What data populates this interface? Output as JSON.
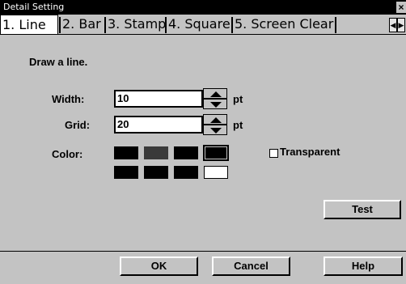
{
  "window": {
    "title": "Detail Setting",
    "close_glyph": "×"
  },
  "tabs": [
    {
      "label": "1. Line",
      "selected": true
    },
    {
      "label": "2. Bar",
      "selected": false
    },
    {
      "label": "3. Stamp",
      "selected": false
    },
    {
      "label": "4. Square",
      "selected": false
    },
    {
      "label": "5. Screen Clear",
      "selected": false
    }
  ],
  "tab_scroll": {
    "left_icon": "chevron-left-icon",
    "right_icon": "chevron-right-icon"
  },
  "panel": {
    "heading": "Draw a line.",
    "width": {
      "label": "Width:",
      "value": "10",
      "unit": "pt"
    },
    "grid": {
      "label": "Grid:",
      "value": "20",
      "unit": "pt"
    },
    "color": {
      "label": "Color:",
      "swatches": [
        "#000000",
        "#3a3a3a",
        "#000000",
        "#000000",
        "#000000",
        "#000000",
        "#000000",
        "#ffffff"
      ]
    },
    "transparent": {
      "label": "Transparent",
      "checked": false
    },
    "test_label": "Test"
  },
  "footer": {
    "ok_label": "OK",
    "cancel_label": "Cancel",
    "help_label": "Help"
  }
}
